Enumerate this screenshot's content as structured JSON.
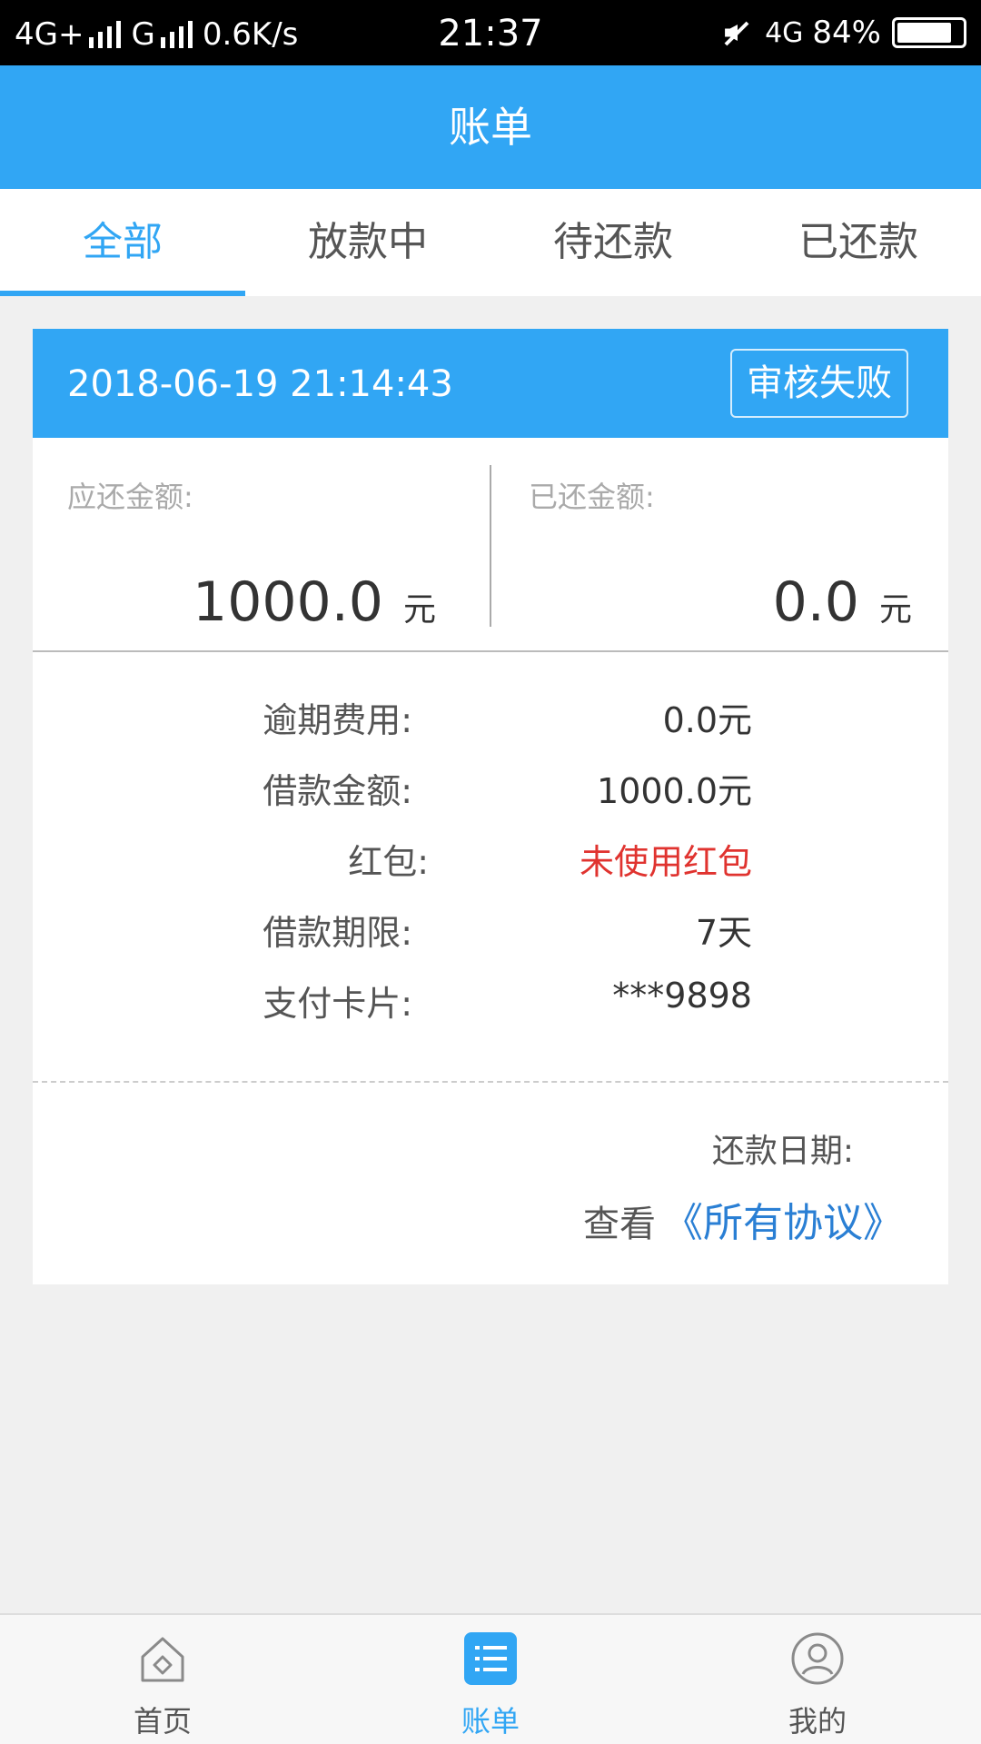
{
  "status_bar": {
    "network1": "4G+",
    "network2": "G",
    "speed": "0.6K/s",
    "time": "21:37",
    "network3": "4G",
    "battery_pct": "84%",
    "battery_level": 0.84
  },
  "header": {
    "title": "账单"
  },
  "tabs": [
    {
      "label": "全部",
      "active": true
    },
    {
      "label": "放款中",
      "active": false
    },
    {
      "label": "待还款",
      "active": false
    },
    {
      "label": "已还款",
      "active": false
    }
  ],
  "bill": {
    "datetime": "2018-06-19 21:14:43",
    "status": "审核失败",
    "due_label": "应还金额:",
    "due_amount": "1000.0",
    "due_unit": "元",
    "paid_label": "已还金额:",
    "paid_amount": "0.0",
    "paid_unit": "元",
    "details": [
      {
        "label": "逾期费用:",
        "value": "0.0元"
      },
      {
        "label": "借款金额:",
        "value": "1000.0元"
      },
      {
        "label": "红包:",
        "value": "未使用红包",
        "highlight": true
      },
      {
        "label": "借款期限:",
        "value": "7天"
      },
      {
        "label": "支付卡片:",
        "value": "***9898"
      }
    ],
    "repay_date_label": "还款日期:",
    "agreement_prefix": "查看",
    "agreement_link": "《所有协议》"
  },
  "bottom_nav": [
    {
      "label": "首页",
      "icon": "home-icon",
      "active": false
    },
    {
      "label": "账单",
      "icon": "list-icon",
      "active": true
    },
    {
      "label": "我的",
      "icon": "user-icon",
      "active": false
    }
  ],
  "colors": {
    "primary": "#31a6f4",
    "highlight": "#e0332f",
    "link": "#2a7fd4"
  }
}
